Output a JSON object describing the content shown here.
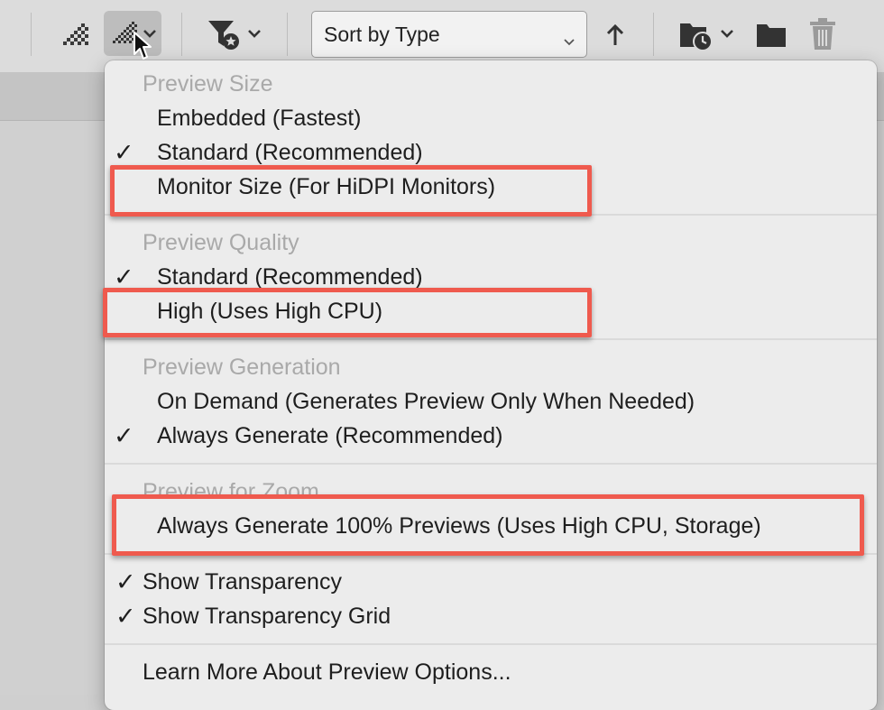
{
  "toolbar": {
    "sort": {
      "label": "Sort by Type"
    },
    "icons": [
      "thumbnail-quality-icon",
      "preview-quality-menu-icon",
      "filter-icon",
      "sort-ascending-icon",
      "recent-folder-icon",
      "new-folder-icon",
      "trash-icon"
    ]
  },
  "menu": {
    "sections": [
      {
        "header": "Preview Size",
        "items": [
          {
            "label": "Embedded (Fastest)",
            "checked": false
          },
          {
            "label": "Standard (Recommended)",
            "checked": true
          },
          {
            "label": "Monitor Size (For HiDPI Monitors)",
            "checked": false
          }
        ]
      },
      {
        "header": "Preview Quality",
        "items": [
          {
            "label": "Standard (Recommended)",
            "checked": true
          },
          {
            "label": "High (Uses High CPU)",
            "checked": false
          }
        ]
      },
      {
        "header": "Preview Generation",
        "items": [
          {
            "label": "On Demand (Generates Preview Only When Needed)",
            "checked": false
          },
          {
            "label": "Always Generate (Recommended)",
            "checked": true
          }
        ]
      },
      {
        "header": "Preview for Zoom",
        "items": [
          {
            "label": "Always Generate 100% Previews (Uses High CPU, Storage)",
            "checked": false
          }
        ]
      }
    ],
    "options": [
      {
        "label": "Show Transparency",
        "checked": true
      },
      {
        "label": "Show Transparency Grid",
        "checked": true
      }
    ],
    "footer": {
      "label": "Learn More About Preview Options..."
    },
    "checkmark": "✓"
  },
  "colors": {
    "highlight": "#ef5a4e",
    "menu_bg": "#ececec",
    "header_text": "#a9a9a9"
  }
}
